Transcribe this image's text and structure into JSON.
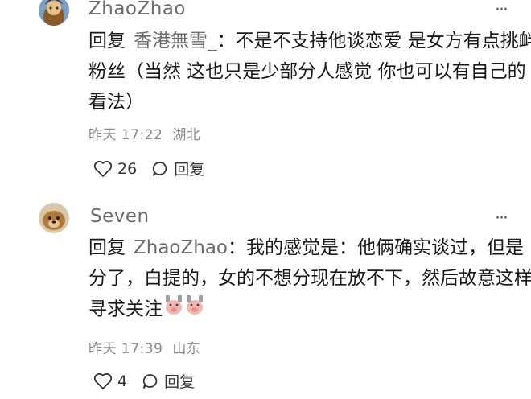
{
  "comments": [
    {
      "username": "ZhaoZhao",
      "reply_prefix": "回复",
      "reply_target": "香港無雪_",
      "separator": "：",
      "text": "不是不支持他谈恋爱 是女方有点挑衅粉丝（当然 这也只是少部分人感觉 你也可以有自己的看法）",
      "time": "昨天 17:22",
      "location": "湖北",
      "likes": "26",
      "reply_label": "回复",
      "more_label": "···"
    },
    {
      "username": "Seven",
      "reply_prefix": "回复",
      "reply_target": "ZhaoZhao",
      "separator": "：",
      "text": "我的感觉是：他俩确实谈过，但是分了，白提的，女的不想分现在放不下，然后故意这样寻求关注",
      "time": "昨天 17:39",
      "location": "山东",
      "likes": "4",
      "reply_label": "回复",
      "more_label": "···",
      "emoji": [
        "pig-face-emoji",
        "pig-face-emoji"
      ]
    }
  ]
}
